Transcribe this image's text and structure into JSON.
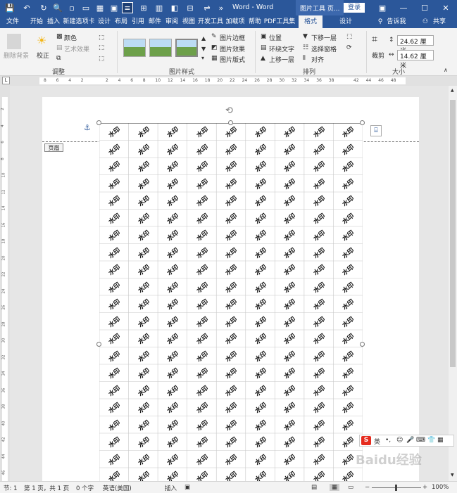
{
  "title_bar": {
    "doc_title": "Word - Word",
    "context_tools": "图片工具",
    "page_tab": "页...",
    "login": "登录"
  },
  "tabs": [
    "文件",
    "开始",
    "插入",
    "新建选项卡",
    "设计",
    "布局",
    "引用",
    "邮件",
    "审阅",
    "视图",
    "开发工具",
    "加载项",
    "帮助",
    "PDF工具集",
    "格式",
    "设计"
  ],
  "tell_me": "告诉我",
  "share": "共享",
  "ribbon": {
    "remove_bg": "删除背景",
    "correct": "校正",
    "color": "颜色",
    "art_effect": "艺术效果",
    "group_adjust": "调整",
    "group_styles": "图片样式",
    "pic_border": "图片边框",
    "pic_effect": "图片效果",
    "pic_layout": "图片版式",
    "position": "位置",
    "wrap_text": "环绕文字",
    "bring_forward": "上移一层",
    "send_back": "下移一层",
    "selection_pane": "选择窗格",
    "align": "对齐",
    "group_arrange": "排列",
    "crop": "裁剪",
    "height": "24.62 厘米",
    "width": "14.62 厘米",
    "group_size": "大小"
  },
  "ruler_ticks": [
    "8",
    "6",
    "4",
    "2",
    "",
    "2",
    "4",
    "6",
    "8",
    "10",
    "12",
    "14",
    "16",
    "18",
    "20",
    "22",
    "24",
    "26",
    "28",
    "30",
    "32",
    "34",
    "36",
    "38",
    "",
    "42",
    "44",
    "46",
    "48"
  ],
  "vruler_ticks": [
    "2",
    "4",
    "6",
    "8",
    "10",
    "12",
    "14",
    "16",
    "18",
    "20",
    "22",
    "24",
    "26",
    "28",
    "30",
    "32",
    "34",
    "36",
    "38",
    "40",
    "42",
    "44",
    "46"
  ],
  "header_label": "页眉",
  "watermark_text": "水印",
  "status": {
    "section": "节: 1",
    "page": "第 1 页，共 1 页",
    "words": "0 个字",
    "lang": "英语(美国)",
    "insert": "插入",
    "zoom": "100%"
  },
  "ime": {
    "lang": "英"
  },
  "baidu": "Baidu经验"
}
